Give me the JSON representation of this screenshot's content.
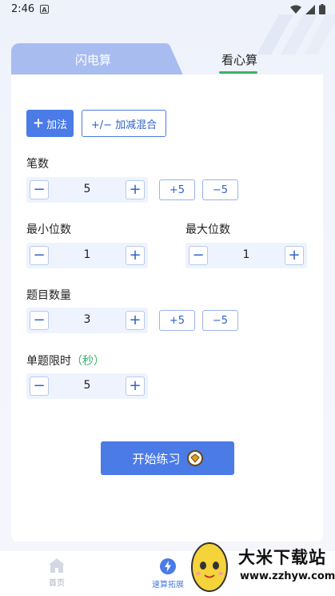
{
  "status_bar": {
    "time": "2:46",
    "notif": "A"
  },
  "tabs": {
    "left": "闪电算",
    "right": "看心算"
  },
  "modes": {
    "add": "加法",
    "mixed": "+/− 加减混合"
  },
  "fields": {
    "strokes": {
      "label": "笔数",
      "value": "5",
      "inc": "+5",
      "dec": "−5"
    },
    "min_digits": {
      "label": "最小位数",
      "value": "1"
    },
    "max_digits": {
      "label": "最大位数",
      "value": "1"
    },
    "question_count": {
      "label": "题目数量",
      "value": "3",
      "inc": "+5",
      "dec": "−5"
    },
    "time_limit": {
      "label": "单题限时",
      "unit": "（秒）",
      "value": "5"
    }
  },
  "start_button": "开始练习",
  "bottom_nav": {
    "home": "首页",
    "speed": "速算拓展"
  },
  "watermark": {
    "title": "大米下载站",
    "url": "www.zzhyw.com"
  },
  "colors": {
    "accent": "#4a7be6",
    "tab_inactive": "#a8bcf0",
    "green": "#37b36b"
  }
}
